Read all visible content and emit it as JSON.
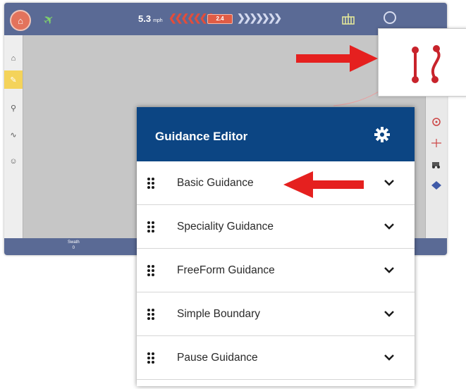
{
  "dialog": {
    "title": "Guidance Editor",
    "items": [
      {
        "label": "Basic Guidance"
      },
      {
        "label": "Speciality Guidance"
      },
      {
        "label": "FreeForm Guidance"
      },
      {
        "label": "Simple Boundary"
      },
      {
        "label": "Pause Guidance"
      }
    ]
  },
  "topbar": {
    "speed": "5.3",
    "speed_unit": "mph",
    "lightbar_value": "2.4"
  },
  "bottombar": {
    "swath_label": "Swath",
    "swath_value": "0"
  },
  "icons": {
    "home": "home-icon",
    "gps": "satellite-icon",
    "settings": "gear-icon",
    "drag": "drag-handle-icon",
    "expand": "chevron-down-icon",
    "guidance": "guidance-lines-icon"
  },
  "colors": {
    "header": "#0c4583",
    "topbar": "#5a6a95",
    "accent_red": "#e5201f",
    "active_tab": "#f4d35a"
  }
}
